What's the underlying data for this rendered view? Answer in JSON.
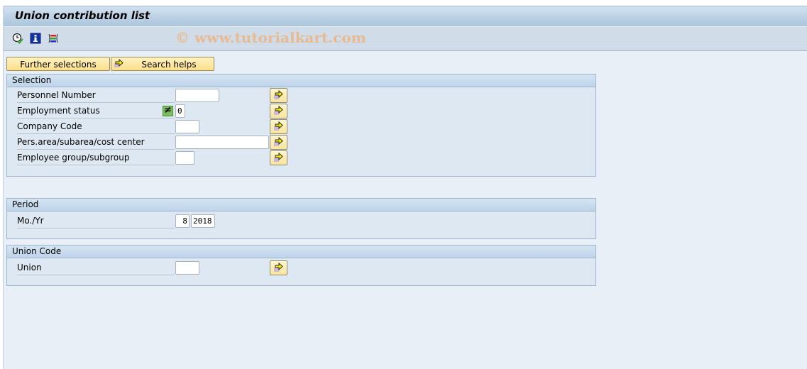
{
  "window": {
    "title": "Union contribution list",
    "watermark": "© www.tutorialkart.com"
  },
  "toolbar": {
    "icons": [
      {
        "name": "execute-icon",
        "glyph": "clock-check"
      },
      {
        "name": "info-icon",
        "glyph": "i"
      },
      {
        "name": "selection-options-icon",
        "glyph": "bars"
      }
    ]
  },
  "buttons": {
    "further_selections": "Further selections",
    "search_helps": "Search helps"
  },
  "selection": {
    "title": "Selection",
    "fields": [
      {
        "label": "Personnel Number",
        "value": ""
      },
      {
        "label": "Employment status",
        "value": "0",
        "operator": "≠"
      },
      {
        "label": "Company Code",
        "value": ""
      },
      {
        "label": "Pers.area/subarea/cost center",
        "value": ""
      },
      {
        "label": "Employee group/subgroup",
        "value": ""
      }
    ]
  },
  "period": {
    "title": "Period",
    "label": "Mo./Yr",
    "month": "8",
    "year": "2018"
  },
  "union_code": {
    "title": "Union Code",
    "label": "Union",
    "value": ""
  },
  "colors": {
    "background": "#e8eff7",
    "button_yellow": "#fbe08a",
    "group_header": "#bfd4ea"
  }
}
